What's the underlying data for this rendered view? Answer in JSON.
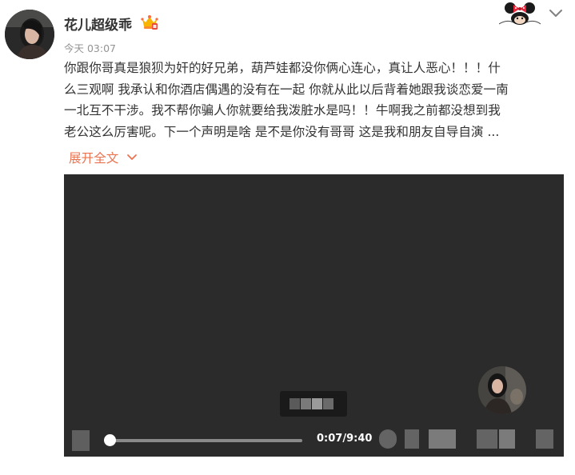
{
  "post": {
    "username": "花儿超级乖",
    "timestamp": "今天 03:07",
    "text_lines": [
      "你跟你哥真是狼狈为奸的好兄弟，葫芦娃都没你俩心连心，真让人恶心！！！什",
      "么三观啊 我承认和你酒店偶遇的没有在一起 你就从此以后背着她跟我谈恋爱一南",
      "一北互不干涉。我不帮你骗人你就要给我泼脏水是吗！！牛啊我之前都没想到我",
      "老公这么厉害呢。下一个声明是啥 是不是你没有哥哥 这是我和朋友自导自演 ..."
    ],
    "expand_label": "展开全文"
  },
  "video": {
    "current_time": "0:07",
    "duration": "9:40",
    "time_display": "0:07/9:40",
    "progress": 0.012
  },
  "icons": {
    "badge": "crown-badge-icon",
    "decoration": "minnie-mouse-icon",
    "menu": "chevron-down-icon",
    "expand": "chevron-down-icon"
  },
  "colors": {
    "accent": "#eb7350",
    "text": "#333333",
    "muted": "#939393",
    "video_bg": "#2b2b2b"
  }
}
